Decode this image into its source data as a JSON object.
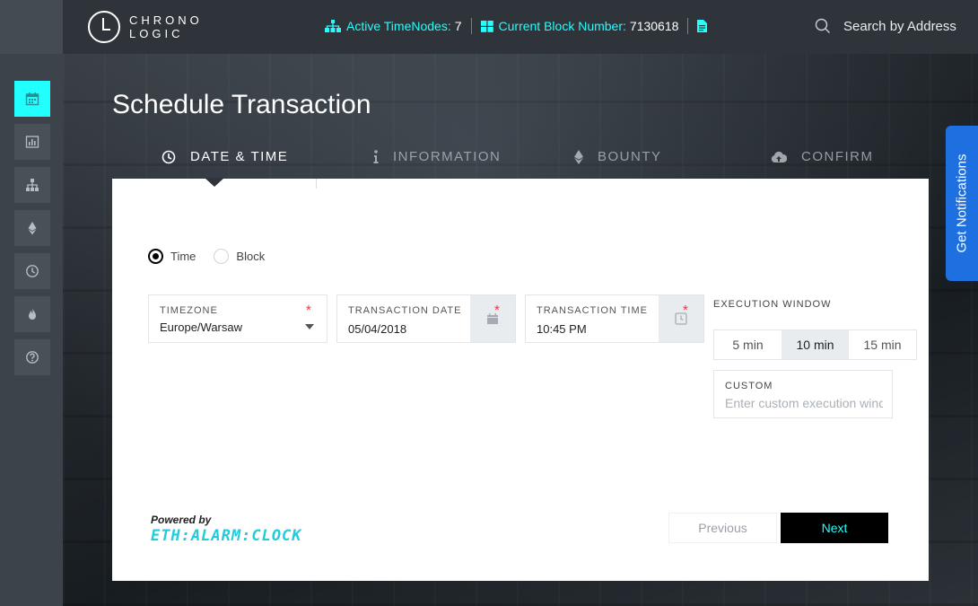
{
  "brand": {
    "line1": "CHRONO",
    "line2": "LOGIC"
  },
  "header": {
    "active_timenodes_label": "Active TimeNodes:",
    "active_timenodes_value": "7",
    "block_number_label": "Current Block Number:",
    "block_number_value": "7130618",
    "search_placeholder": "Search by Address"
  },
  "sidebar": {
    "items": [
      {
        "name": "calendar-icon",
        "active": true
      },
      {
        "name": "chart-icon",
        "active": false
      },
      {
        "name": "sitemap-icon",
        "active": false
      },
      {
        "name": "ethereum-icon",
        "active": false
      },
      {
        "name": "clock-icon",
        "active": false
      },
      {
        "name": "fire-icon",
        "active": false
      },
      {
        "name": "help-icon",
        "active": false
      }
    ]
  },
  "page": {
    "title": "Schedule Transaction"
  },
  "steps": [
    {
      "label": "DATE & TIME",
      "icon": "clock-icon",
      "active": true
    },
    {
      "label": "INFORMATION",
      "icon": "info-icon",
      "active": false
    },
    {
      "label": "BOUNTY",
      "icon": "ethereum-icon",
      "active": false
    },
    {
      "label": "CONFIRM",
      "icon": "cloud-upload-icon",
      "active": false
    }
  ],
  "mode": {
    "options": [
      "Time",
      "Block"
    ],
    "selected": "Time"
  },
  "form": {
    "timezone": {
      "label": "TIMEZONE",
      "value": "Europe/Warsaw"
    },
    "date": {
      "label": "TRANSACTION DATE",
      "value": "05/04/2018"
    },
    "time": {
      "label": "TRANSACTION TIME",
      "value": "10:45 PM"
    },
    "required_mark": "*"
  },
  "execution_window": {
    "title": "EXECUTION WINDOW",
    "options": [
      "5 min",
      "10 min",
      "15 min"
    ],
    "selected": "10 min",
    "custom_label": "CUSTOM",
    "custom_placeholder": "Enter custom execution window"
  },
  "footer": {
    "powered_by": "Powered by",
    "powered_brand": "ETH:ALARM:CLOCK",
    "previous": "Previous",
    "next": "Next"
  },
  "notifications": {
    "label": "Get Notifications"
  },
  "colors": {
    "accent": "#21ffff",
    "notification": "#1e6fe0",
    "required": "#e63946"
  }
}
